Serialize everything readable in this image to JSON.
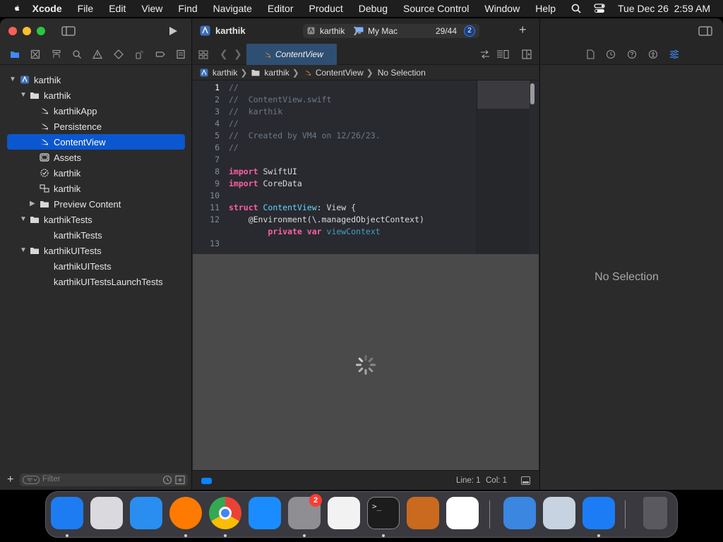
{
  "menubar": {
    "app": "Xcode",
    "items": [
      "File",
      "Edit",
      "View",
      "Find",
      "Navigate",
      "Editor",
      "Product",
      "Debug",
      "Source Control",
      "Window",
      "Help"
    ],
    "datetime": "Tue Dec 26  2:59 AM"
  },
  "toolbar": {
    "project": "karthik",
    "scheme": "karthik",
    "destination": "My Mac",
    "status_count": "29/44",
    "issue_badge": "2"
  },
  "navigator": {
    "tree": [
      {
        "label": "karthik",
        "icon": "xcode-project-icon",
        "disclosure": "open"
      },
      {
        "label": "karthik",
        "icon": "folder-icon",
        "disclosure": "open"
      },
      {
        "label": "karthikApp",
        "icon": "swift-file-icon"
      },
      {
        "label": "Persistence",
        "icon": "swift-file-icon"
      },
      {
        "label": "ContentView",
        "icon": "swift-file-icon",
        "selected": true
      },
      {
        "label": "Assets",
        "icon": "asset-catalog-icon"
      },
      {
        "label": "karthik",
        "icon": "entitlements-icon"
      },
      {
        "label": "karthik",
        "icon": "data-model-icon"
      },
      {
        "label": "Preview Content",
        "icon": "folder-icon",
        "disclosure": "closed"
      },
      {
        "label": "karthikTests",
        "icon": "folder-icon",
        "disclosure": "open"
      },
      {
        "label": "karthikTests",
        "icon": "none"
      },
      {
        "label": "karthikUITests",
        "icon": "folder-icon",
        "disclosure": "open"
      },
      {
        "label": "karthikUITests",
        "icon": "none"
      },
      {
        "label": "karthikUITestsLaunchTests",
        "icon": "none"
      }
    ],
    "filter_placeholder": "Filter"
  },
  "editor": {
    "tab": "ContentView",
    "jumpbar": [
      "karthik",
      "karthik",
      "ContentView",
      "No Selection"
    ],
    "code": [
      {
        "n": "1",
        "tokens": [
          {
            "t": "//",
            "c": "com"
          }
        ]
      },
      {
        "n": "2",
        "tokens": [
          {
            "t": "//  ContentView.swift",
            "c": "com"
          }
        ]
      },
      {
        "n": "3",
        "tokens": [
          {
            "t": "//  karthik",
            "c": "com"
          }
        ]
      },
      {
        "n": "4",
        "tokens": [
          {
            "t": "//",
            "c": "com"
          }
        ]
      },
      {
        "n": "5",
        "tokens": [
          {
            "t": "//  Created by VM4 on 12/26/23.",
            "c": "com"
          }
        ]
      },
      {
        "n": "6",
        "tokens": [
          {
            "t": "//",
            "c": "com"
          }
        ]
      },
      {
        "n": "7",
        "tokens": []
      },
      {
        "n": "8",
        "tokens": [
          {
            "t": "import",
            "c": "kw"
          },
          {
            "t": " SwiftUI",
            "c": "plain"
          }
        ]
      },
      {
        "n": "9",
        "tokens": [
          {
            "t": "import",
            "c": "kw"
          },
          {
            "t": " CoreData",
            "c": "plain"
          }
        ]
      },
      {
        "n": "10",
        "tokens": []
      },
      {
        "n": "11",
        "tokens": [
          {
            "t": "struct",
            "c": "kw"
          },
          {
            "t": " ",
            "c": "plain"
          },
          {
            "t": "ContentView",
            "c": "typ"
          },
          {
            "t": ": View {",
            "c": "plain"
          }
        ]
      },
      {
        "n": "12",
        "tokens": [
          {
            "t": "    @Environment(\\.managedObjectContext)",
            "c": "plain"
          }
        ]
      },
      {
        "n": "",
        "tokens": [
          {
            "t": "        ",
            "c": "plain"
          },
          {
            "t": "private",
            "c": "kw"
          },
          {
            "t": " ",
            "c": "plain"
          },
          {
            "t": "var",
            "c": "kw"
          },
          {
            "t": " ",
            "c": "plain"
          },
          {
            "t": "viewContext",
            "c": "prop"
          }
        ]
      },
      {
        "n": "13",
        "tokens": []
      }
    ],
    "status_line": "Line: 1",
    "status_col": "Col: 1"
  },
  "inspector": {
    "empty_text": "No Selection"
  },
  "dock": {
    "apps": [
      {
        "name": "finder-icon",
        "color": "#1e7cf2"
      },
      {
        "name": "launchpad-icon",
        "color": "#d9d9de"
      },
      {
        "name": "safari-icon",
        "color": "#2a8df0"
      },
      {
        "name": "firefox-icon",
        "color": "#ff7a00"
      },
      {
        "name": "chrome-icon",
        "color": "#ffffff"
      },
      {
        "name": "app-store-icon",
        "color": "#1a8cff"
      },
      {
        "name": "system-settings-icon",
        "color": "#8e8e93",
        "badge": "2"
      },
      {
        "name": "textedit-icon",
        "color": "#f2f2f2"
      },
      {
        "name": "terminal-icon",
        "color": "#1c1c1c"
      },
      {
        "name": "garageband-icon",
        "color": "#c96a1e"
      },
      {
        "name": "vscode-icon",
        "color": "#ffffff"
      },
      {
        "name": "weather-icon",
        "color": "#3a86e0"
      },
      {
        "name": "preview-icon",
        "color": "#c7d3e0"
      },
      {
        "name": "xcode-icon",
        "color": "#1c7cf5"
      },
      {
        "name": "trash-icon",
        "color": "#5a5a5e"
      }
    ]
  }
}
